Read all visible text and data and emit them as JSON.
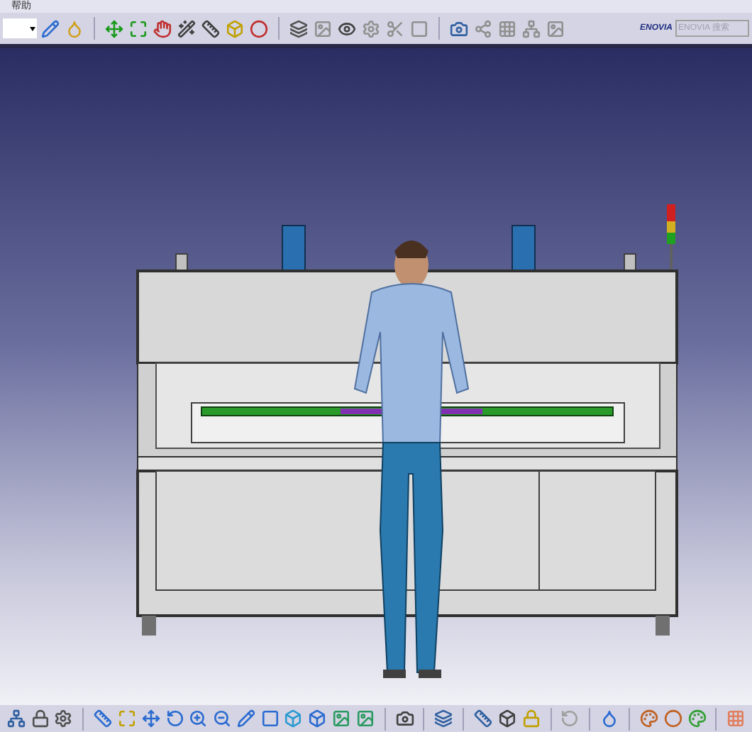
{
  "menu": [
    {
      "label": "帮助"
    }
  ],
  "toolbar": {
    "logo": "ENOVIA",
    "search": {
      "placeholder": "ENOVIA 搜索"
    }
  }
}
